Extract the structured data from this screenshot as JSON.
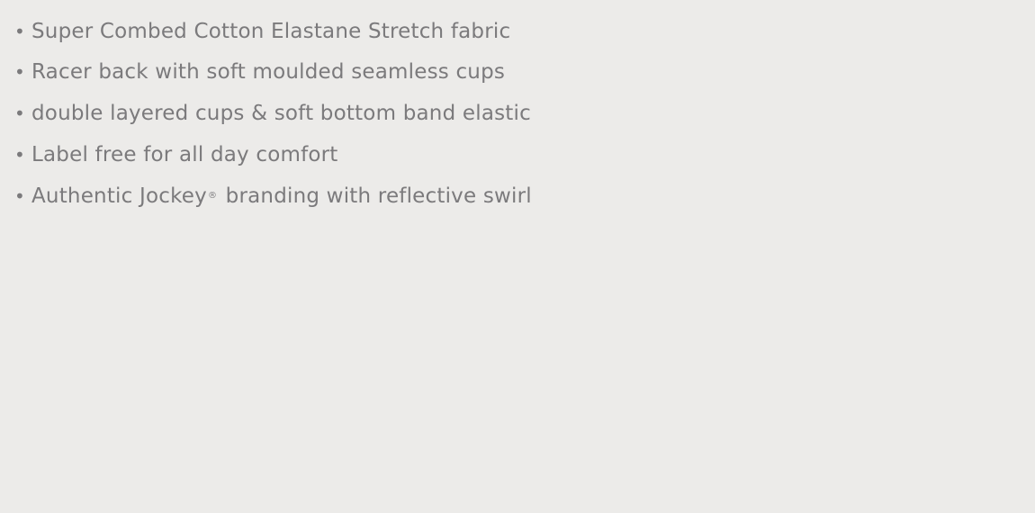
{
  "features": {
    "bullet": "•",
    "items": [
      {
        "text": "Super Combed Cotton Elastane Stretch fabric"
      },
      {
        "text": "Racer back with soft moulded seamless cups"
      },
      {
        "text": "double layered cups & soft bottom band elastic"
      },
      {
        "text": "Label free for all day comfort"
      },
      {
        "text": "Authentic Jockey",
        "mark": "®",
        "suffix": " branding with reflective swirl"
      }
    ]
  }
}
